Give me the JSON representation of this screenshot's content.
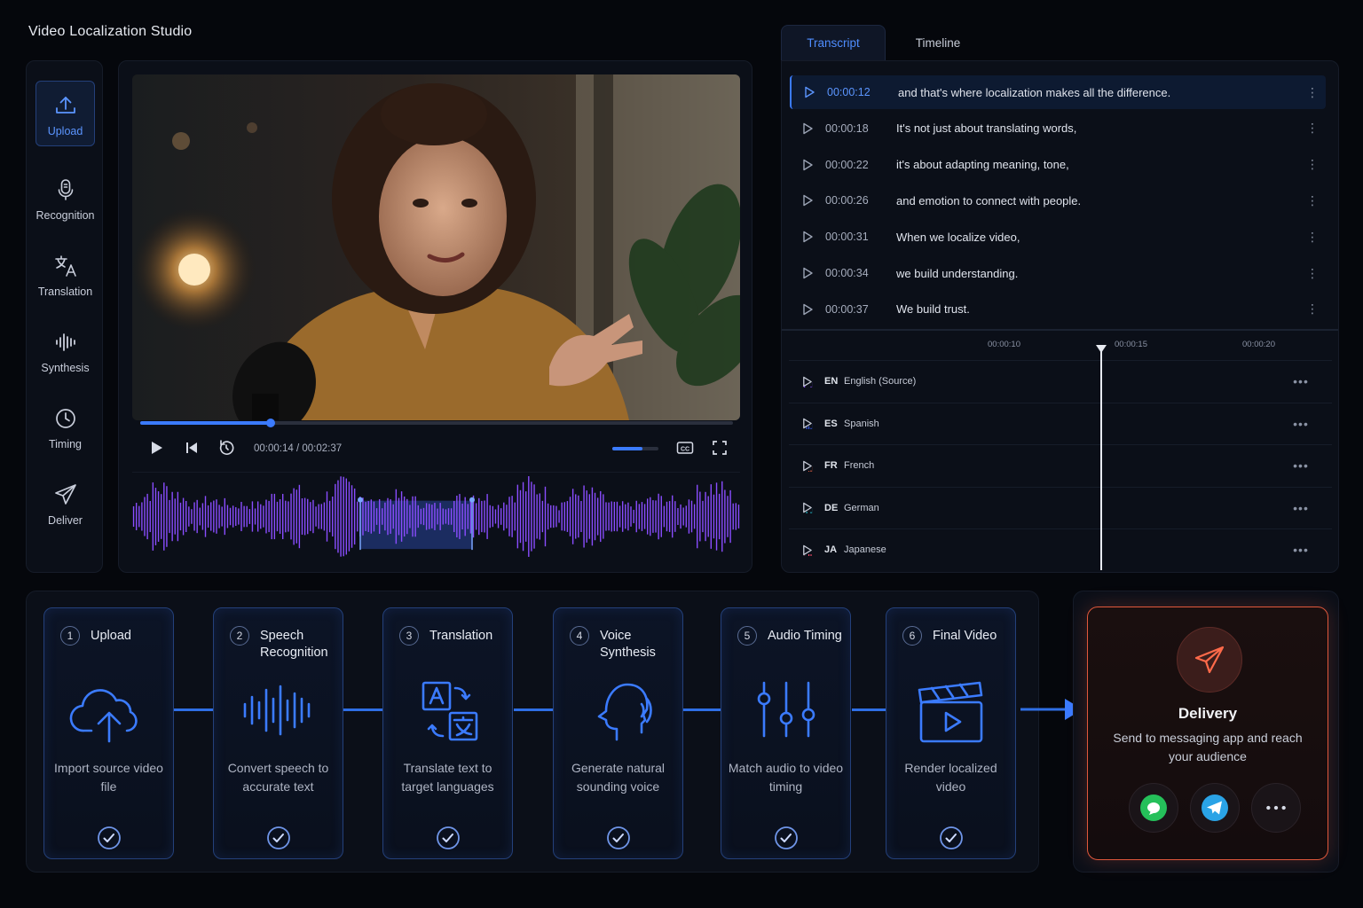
{
  "app": {
    "title": "Video Localization Studio"
  },
  "sidebar": {
    "items": [
      {
        "label": "Upload",
        "icon": "upload-icon",
        "active": true
      },
      {
        "label": "Recognition",
        "icon": "microphone-icon"
      },
      {
        "label": "Translation",
        "icon": "translate-icon"
      },
      {
        "label": "Synthesis",
        "icon": "waveform-icon"
      },
      {
        "label": "Timing",
        "icon": "clock-icon"
      },
      {
        "label": "Deliver",
        "icon": "send-icon"
      }
    ]
  },
  "player": {
    "current_time": "00:00:14",
    "duration": "00:02:37",
    "time_readout": "00:00:14 / 00:02:37",
    "progress": 0.22,
    "volume": 0.65,
    "cc_label": "CC"
  },
  "transcript": {
    "tabs": [
      {
        "label": "Transcript",
        "active": true
      },
      {
        "label": "Timeline"
      }
    ],
    "rows": [
      {
        "time": "00:00:12",
        "text": "and that's where localization makes all the difference.",
        "active": true
      },
      {
        "time": "00:00:18",
        "text": "It's not just about translating words,"
      },
      {
        "time": "00:00:22",
        "text": "it's about adapting meaning, tone,"
      },
      {
        "time": "00:00:26",
        "text": "and emotion to connect with people."
      },
      {
        "time": "00:00:31",
        "text": "When we localize video,"
      },
      {
        "time": "00:00:34",
        "text": "we build understanding."
      },
      {
        "time": "00:00:37",
        "text": "We build trust."
      }
    ]
  },
  "timeline": {
    "ticks": [
      "00:00:10",
      "00:00:15",
      "00:00:20"
    ],
    "lanes": [
      {
        "code": "EN",
        "name": "English (Source)",
        "color": "#8a4dff"
      },
      {
        "code": "ES",
        "name": "Spanish",
        "color": "#3d63ff"
      },
      {
        "code": "FR",
        "name": "French",
        "color": "#ff6a4a"
      },
      {
        "code": "DE",
        "name": "German",
        "color": "#22b8c8"
      },
      {
        "code": "JA",
        "name": "Japanese",
        "color": "#ff4d6d"
      }
    ],
    "more_label": "•••"
  },
  "pipeline": {
    "steps": [
      {
        "num": "1",
        "title": "Upload",
        "desc": "Import source video file",
        "icon": "cloud-upload-icon"
      },
      {
        "num": "2",
        "title": "Speech Recognition",
        "desc": "Convert speech to accurate text",
        "icon": "sound-wave-icon"
      },
      {
        "num": "3",
        "title": "Translation",
        "desc": "Translate text to target languages",
        "icon": "translate-icon"
      },
      {
        "num": "4",
        "title": "Voice Synthesis",
        "desc": "Generate natural sounding voice",
        "icon": "speaking-head-icon"
      },
      {
        "num": "5",
        "title": "Audio Timing",
        "desc": "Match audio to video timing",
        "icon": "sliders-icon"
      },
      {
        "num": "6",
        "title": "Final Video",
        "desc": "Render localized video",
        "icon": "clapperboard-icon"
      }
    ]
  },
  "delivery": {
    "title": "Delivery",
    "desc": "Send to messaging app and reach your audience",
    "apps": [
      {
        "icon": "chat-bubble-icon",
        "color": "#25c05a"
      },
      {
        "icon": "paper-plane-icon",
        "color": "#2aa3e6"
      },
      {
        "icon": "more-dots-icon",
        "color": "#d7dbe6"
      }
    ]
  },
  "colors": {
    "accent": "#3b7bff",
    "delivery": "#e0583c"
  }
}
